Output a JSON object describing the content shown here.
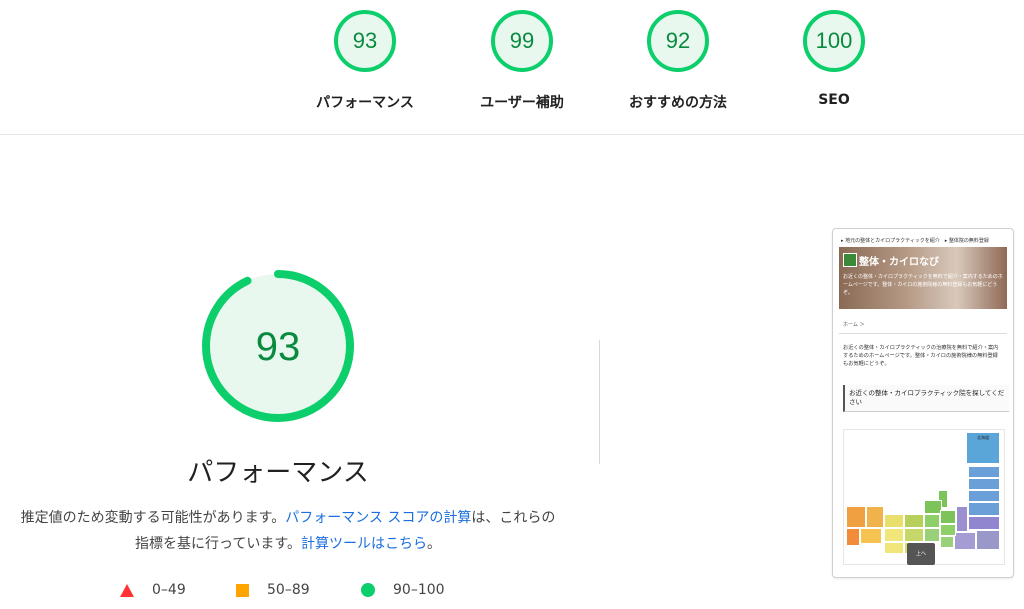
{
  "scores": [
    {
      "value": "93",
      "label": "パフォーマンス"
    },
    {
      "value": "99",
      "label": "ユーザー補助"
    },
    {
      "value": "92",
      "label": "おすすめの方法"
    },
    {
      "value": "100",
      "label": "SEO"
    }
  ],
  "main": {
    "score": "93",
    "score_fraction": 0.93,
    "title": "パフォーマンス",
    "desc_text_1": "推定値のため変動する可能性があります。",
    "desc_link_1": "パフォーマンス スコアの計算",
    "desc_text_2": "は、これらの指標を基に行っています。",
    "desc_link_2": "計算ツールはこちら",
    "desc_text_3": "。"
  },
  "legend": [
    {
      "label": "0–49"
    },
    {
      "label": "50–89"
    },
    {
      "label": "90–100"
    }
  ],
  "colors": {
    "pass": "#0cce6b",
    "average": "#ffa400",
    "fail": "#ff3333",
    "link": "#1a6fdc"
  },
  "screenshot": {
    "breadcrumb": "▸ 地元の整体とカイロプラクティックを紹介　▸ 整体院の無料登録",
    "brand": "整体・カイロなび",
    "hero_intro": "お近くの整体・カイロプラクティックを無料で紹介・案内するためのホームページです。整体・カイロの施術院様の無料登録もお気軽にどうぞ。",
    "home": "ホーム ＞",
    "body_text": "お近くの整体・カイロプラクティックの治療院を無料で紹介・案内するためのホームページです。整体・カイロの施術院様の無料登録もお気軽にどうぞ。",
    "heading": "お近くの整体・カイロプラクティック院を探してください",
    "region_hokkaido": "北海道",
    "top_button": "上へ"
  }
}
